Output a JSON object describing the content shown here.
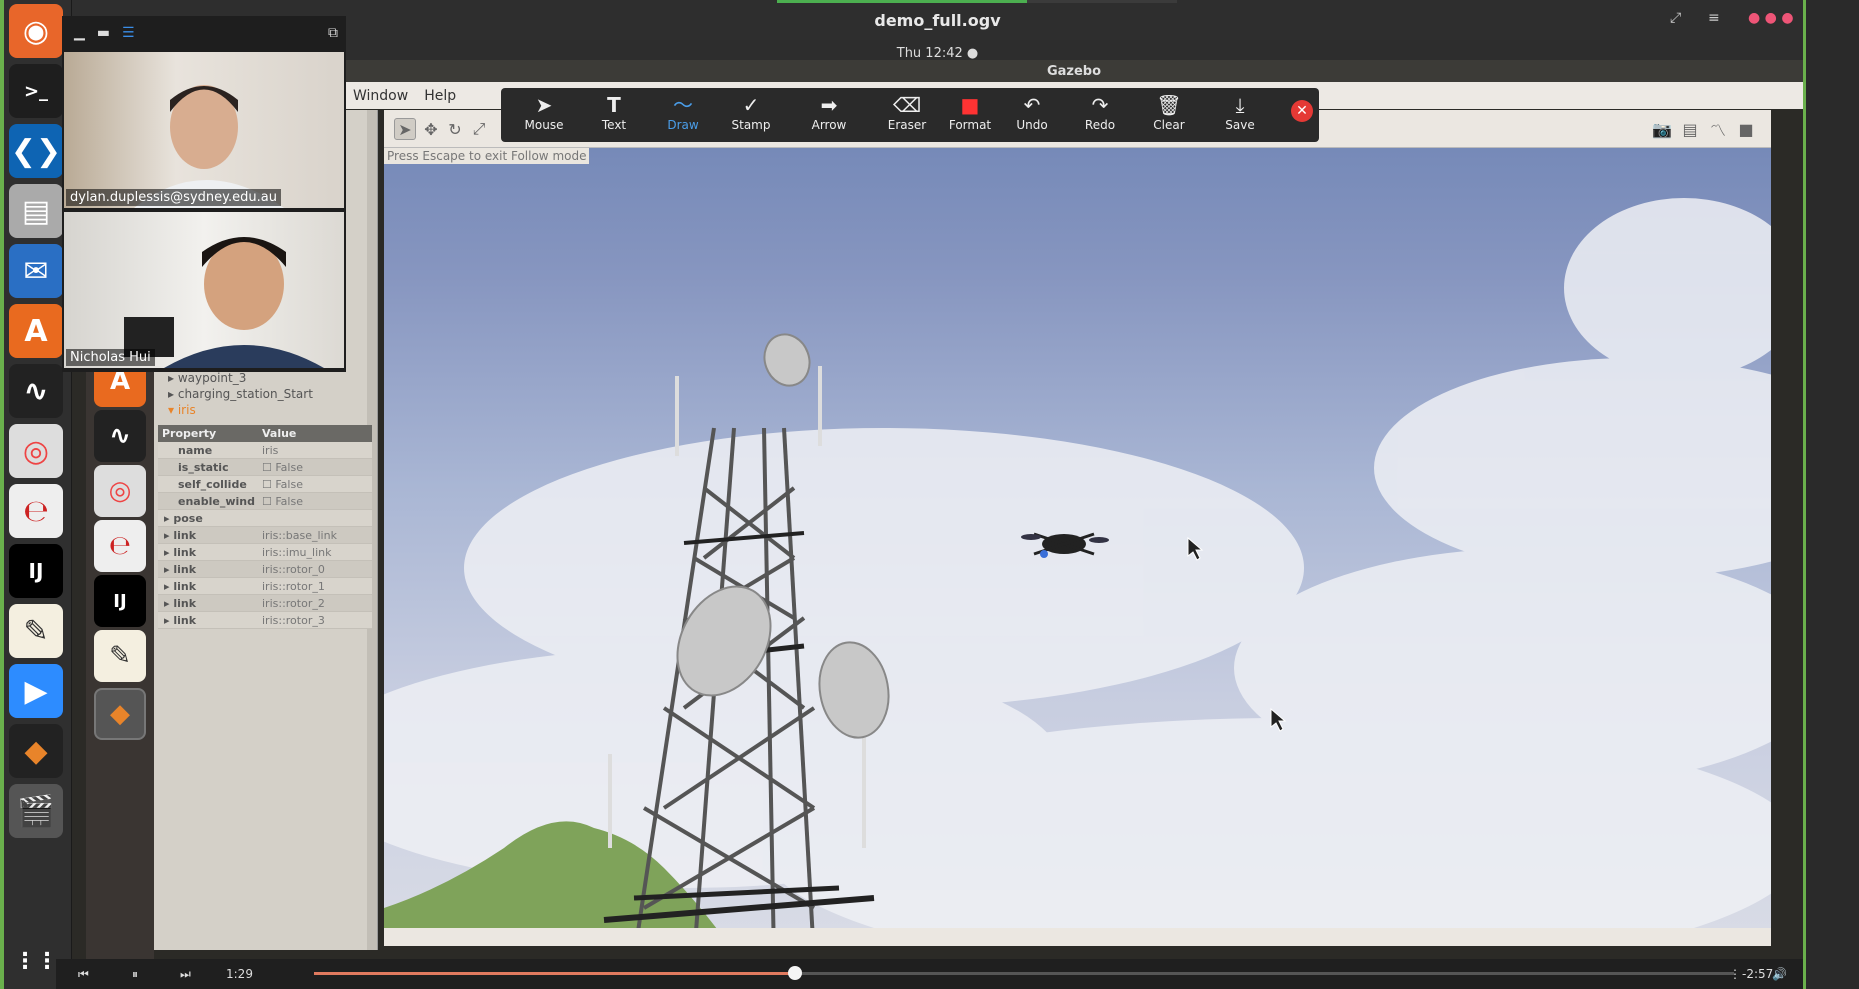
{
  "video": {
    "title": "demo_full.ogv",
    "time_current": "1:29",
    "time_remaining": "-2:57",
    "progress": 0.339
  },
  "topbar": {
    "clock": "Thu 12:42 ●"
  },
  "gazebo": {
    "window_title": "Gazebo",
    "menu": [
      "Window",
      "Help"
    ],
    "follow_hint": "Press Escape to exit Follow mode"
  },
  "annotation_toolbar": {
    "tools": [
      "Mouse",
      "Text",
      "Draw",
      "Stamp",
      "Arrow",
      "Eraser",
      "Format",
      "Undo",
      "Redo",
      "Clear",
      "Save"
    ],
    "active": "Draw"
  },
  "participants": [
    {
      "name": "dylan.duplessis@sydney.edu.au"
    },
    {
      "name": "Nicholas Hui"
    }
  ],
  "model_tree": [
    "waypoint_3",
    "charging_station_Start",
    "iris"
  ],
  "property_panel": {
    "headers": [
      "Property",
      "Value"
    ],
    "rows": [
      {
        "prop": "name",
        "value": "iris"
      },
      {
        "prop": "is_static",
        "value": "False"
      },
      {
        "prop": "self_collide",
        "value": "False"
      },
      {
        "prop": "enable_wind",
        "value": "False"
      },
      {
        "prop": "pose",
        "value": ""
      },
      {
        "prop": "link",
        "value": "iris::base_link"
      },
      {
        "prop": "link",
        "value": "iris::imu_link"
      },
      {
        "prop": "link",
        "value": "iris::rotor_0"
      },
      {
        "prop": "link",
        "value": "iris::rotor_1"
      },
      {
        "prop": "link",
        "value": "iris::rotor_2"
      },
      {
        "prop": "link",
        "value": "iris::rotor_3"
      }
    ]
  },
  "colors": {
    "accent_green": "#6ab04c",
    "progress": "#e07a5f",
    "draw_active": "#4a9de8",
    "close": "#e53935"
  }
}
